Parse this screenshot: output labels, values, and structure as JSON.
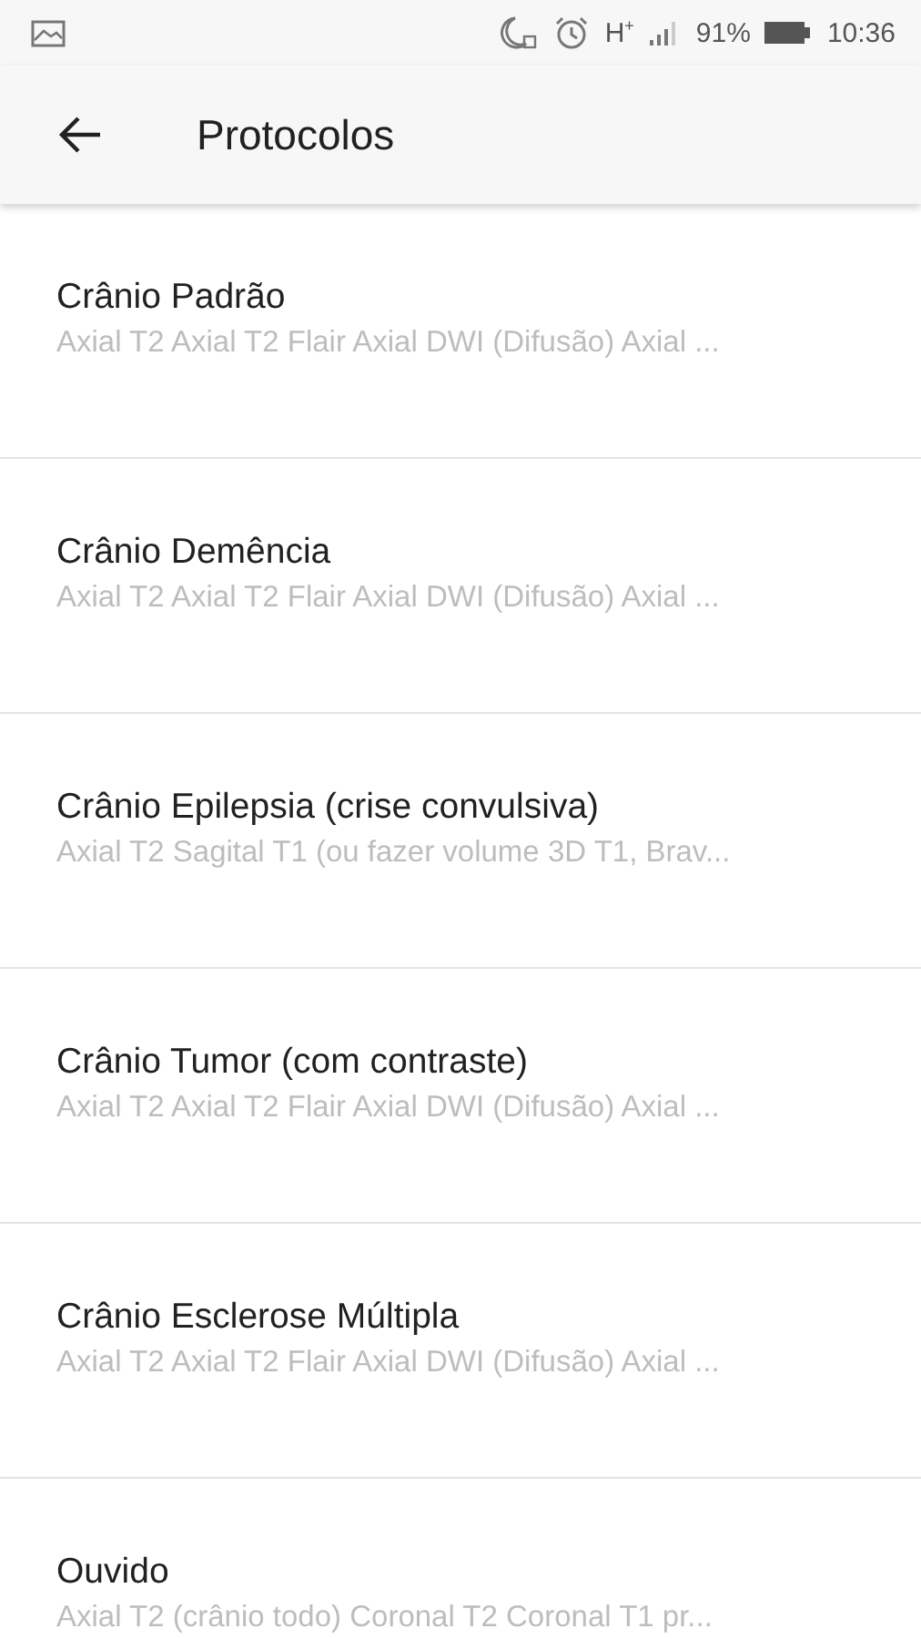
{
  "status_bar": {
    "network": "H$^{+}$",
    "battery_text": "91%",
    "time": "10:36"
  },
  "app_bar": {
    "title": "Protocolos"
  },
  "protocols": [
    {
      "title": "Crânio Padrão",
      "summary": "Axial T2 Axial T2 Flair Axial DWI (Difusão) Axial ..."
    },
    {
      "title": "Crânio Demência",
      "summary": "Axial T2 Axial T2 Flair Axial DWI (Difusão) Axial ..."
    },
    {
      "title": "Crânio Epilepsia (crise convulsiva)",
      "summary": "Axial T2 Sagital T1 (ou fazer volume 3D T1, Brav..."
    },
    {
      "title": "Crânio Tumor (com contraste)",
      "summary": "Axial T2 Axial T2 Flair Axial DWI (Difusão) Axial ..."
    },
    {
      "title": "Crânio Esclerose Múltipla",
      "summary": "Axial T2 Axial T2 Flair Axial DWI (Difusão) Axial ..."
    },
    {
      "title": "Ouvido",
      "summary": "Axial T2 (crânio todo) Coronal T2 Coronal T1 pr..."
    }
  ]
}
